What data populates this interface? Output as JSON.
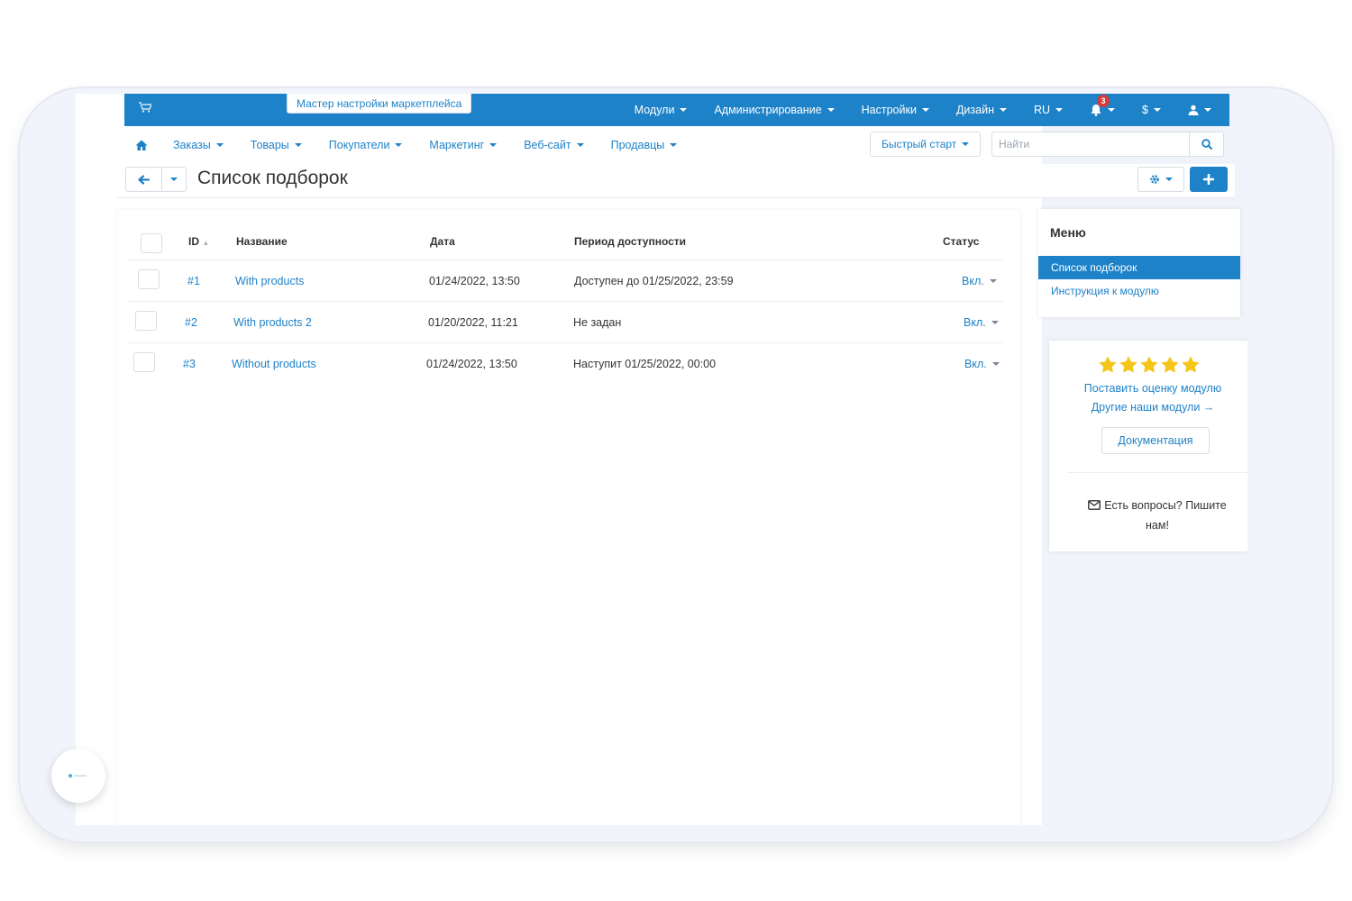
{
  "topbar": {
    "wizard_label": "Мастер настройки маркетплейса",
    "nav": [
      {
        "label": "Модули"
      },
      {
        "label": "Администрирование"
      },
      {
        "label": "Настройки"
      },
      {
        "label": "Дизайн"
      },
      {
        "label": "RU"
      }
    ],
    "notifications_count": "3",
    "currency_label": "$"
  },
  "subnav": {
    "links": [
      {
        "label": "Заказы"
      },
      {
        "label": "Товары"
      },
      {
        "label": "Покупатели"
      },
      {
        "label": "Маркетинг"
      },
      {
        "label": "Веб-сайт"
      },
      {
        "label": "Продавцы"
      }
    ],
    "quickstart_label": "Быстрый старт",
    "search_placeholder": "Найти",
    "search_value": ""
  },
  "toolbar": {
    "title": "Список подборок"
  },
  "table": {
    "headers": {
      "id": "ID",
      "name": "Название",
      "date": "Дата",
      "period": "Период доступности",
      "status": "Статус"
    },
    "rows": [
      {
        "id": "#1",
        "name": "With products",
        "date": "01/24/2022, 13:50",
        "period": "Доступен до 01/25/2022, 23:59",
        "status": "Вкл."
      },
      {
        "id": "#2",
        "name": "With products 2",
        "date": "01/20/2022, 11:21",
        "period": "Не задан",
        "status": "Вкл."
      },
      {
        "id": "#3",
        "name": "Without products",
        "date": "01/24/2022, 13:50",
        "period": "Наступит 01/25/2022, 00:00",
        "status": "Вкл."
      }
    ]
  },
  "sidebar": {
    "menu_title": "Меню",
    "menu_items": [
      {
        "label": "Список подборок",
        "active": true
      },
      {
        "label": "Инструкция к модулю",
        "active": false
      }
    ],
    "promo": {
      "rating_stars": 5,
      "rate_link": "Поставить оценку модулю",
      "other_modules_link": "Другие наши модули →",
      "docs_button": "Документация",
      "contact_text": "Есть вопросы? Пишите нам!"
    }
  },
  "colors": {
    "primary": "#1e82c8",
    "star": "#f5c518",
    "badge": "#d63b3b"
  }
}
